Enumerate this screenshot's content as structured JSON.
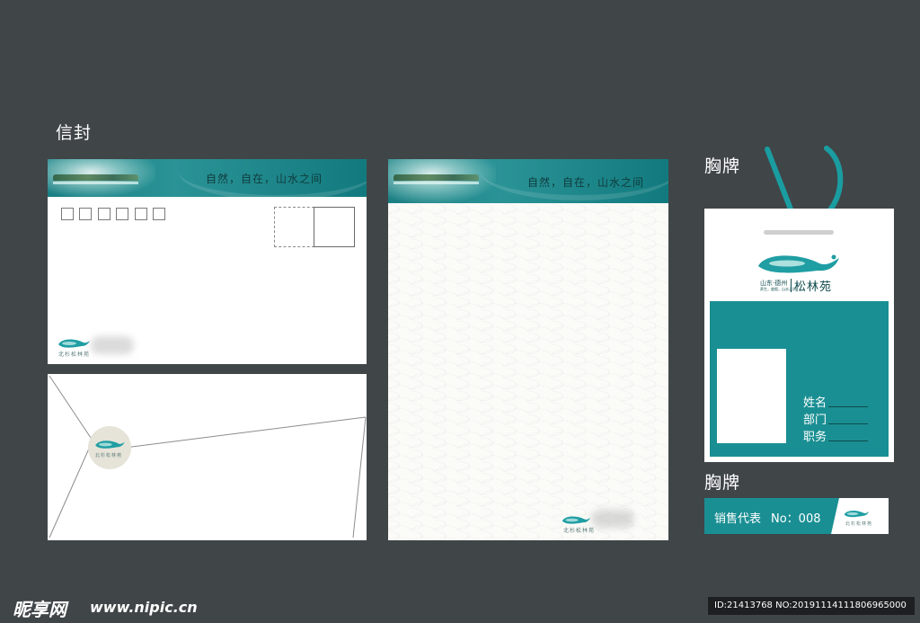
{
  "sections": {
    "envelope_label": "信封",
    "badge_label": "胸牌",
    "name_tag_label": "胸牌"
  },
  "envelope": {
    "slogan": "自然，自在，山水之间",
    "zip_boxes": 6,
    "logo_caption": "北杉松林苑"
  },
  "envelope_back": {
    "seal_caption": "北杉松林苑"
  },
  "letterhead": {
    "slogan": "自然，自在，山水之间",
    "logo_caption": "北杉松林苑"
  },
  "badge": {
    "brand_left_top": "山东·德州",
    "brand_left_bottom": "养生，度假，山水之间",
    "brand_name": "松林苑",
    "fields": [
      "姓名",
      "部门",
      "职务"
    ]
  },
  "name_tag": {
    "title": "销售代表",
    "number": "No：008",
    "logo_caption": "北杉松林苑"
  },
  "watermark": {
    "brand": "昵享网",
    "url": "www.nipic.cn",
    "id_text": "ID:21413768 NO:20191114111806965000"
  },
  "colors": {
    "background": "#404548",
    "teal": "#1a8f93",
    "paper": "#ffffff"
  }
}
